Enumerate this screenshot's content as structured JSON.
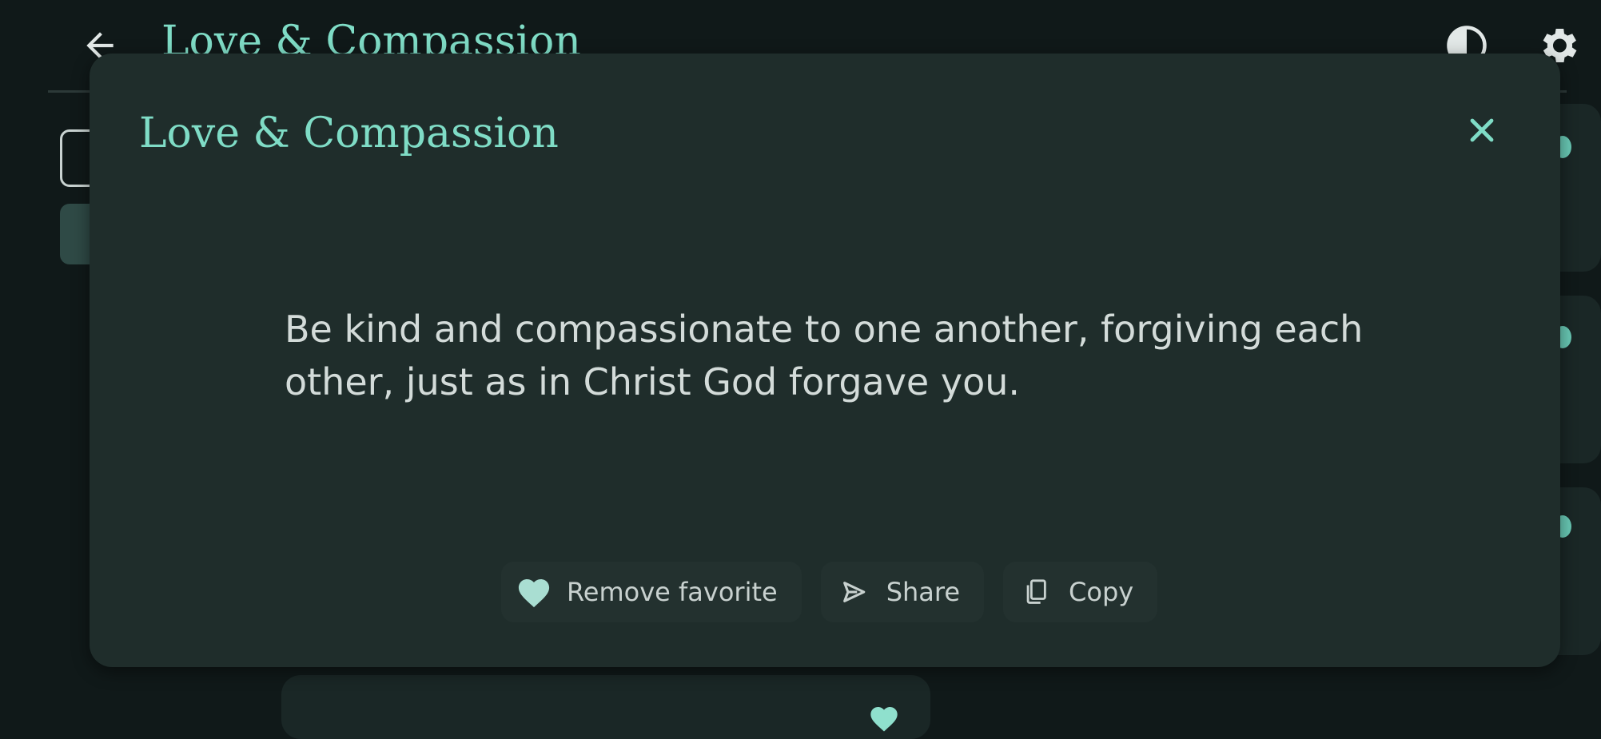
{
  "app_bar": {
    "title": "Love & Compassion",
    "back_icon": "arrow-left-icon",
    "theme_icon": "contrast-icon",
    "settings_icon": "gear-icon"
  },
  "dialog": {
    "title": "Love & Compassion",
    "close_icon": "close-icon",
    "quote": "Be kind and compassionate to one another, forgiving each other, just as in Christ God forgave you.",
    "actions": {
      "favorite": {
        "label": "Remove favorite",
        "icon": "heart-icon"
      },
      "share": {
        "label": "Share",
        "icon": "send-icon"
      },
      "copy": {
        "label": "Copy",
        "icon": "copy-icon"
      }
    }
  },
  "colors": {
    "accent": "#7fdcc6",
    "background": "#101919",
    "dialog_surface": "#1f2d2b",
    "text": "#d3dbd9"
  }
}
